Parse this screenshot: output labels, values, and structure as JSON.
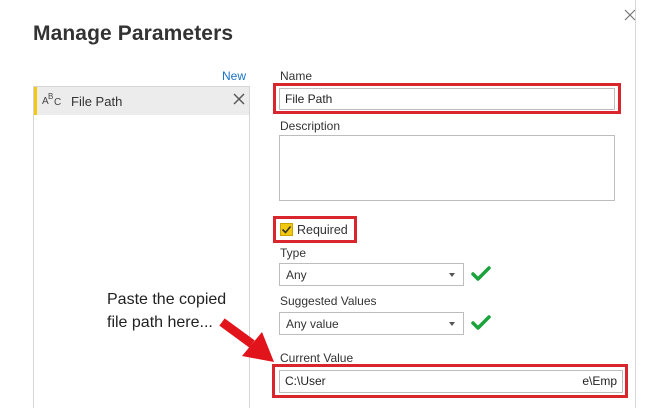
{
  "dialog": {
    "title": "Manage Parameters",
    "close_icon": "close-icon"
  },
  "list": {
    "new_label": "New",
    "items": [
      {
        "label": "File Path",
        "type_icon": "text-type-abc-icon",
        "remove_icon": "remove-icon"
      }
    ]
  },
  "form": {
    "name_label": "Name",
    "name_value": "File Path",
    "description_label": "Description",
    "description_value": "",
    "required_label": "Required",
    "required_checked": true,
    "type_label": "Type",
    "type_value": "Any",
    "suggested_label": "Suggested Values",
    "suggested_value": "Any value",
    "current_label": "Current Value",
    "current_value_left": "C:\\User",
    "current_value_right": "e\\Emp"
  },
  "annotation": {
    "line1": "Paste the copied",
    "line2": "file path here..."
  },
  "colors": {
    "accent_yellow": "#f2c811",
    "highlight_red": "#d9262c",
    "check_green": "#1aa33b",
    "link_blue": "#1a73c6"
  }
}
